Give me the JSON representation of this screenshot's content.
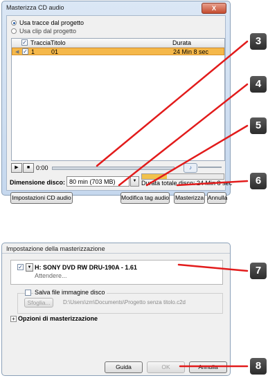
{
  "dialog1": {
    "title": "Masterizza CD audio",
    "radio_use_tracks": "Usa tracce dal progetto",
    "radio_use_clips": "Usa clip dal progetto",
    "table": {
      "col_track": "Traccia",
      "col_title": "Titolo",
      "col_duration": "Durata",
      "rows": [
        {
          "track": "1",
          "title": "01",
          "duration": "24 Min 8 sec",
          "checked": true
        }
      ]
    },
    "time_display": "0:00",
    "disc_size_label": "Dimensione disco:",
    "disc_size_value": "80 min (703 MB)",
    "total_duration": "Durata totale disco: 24 Min 8 sec",
    "btn_cd_settings": "Impostazioni CD audio",
    "btn_edit_tags": "Modifica tag audio",
    "btn_burn": "Masterizza",
    "btn_cancel": "Annulla",
    "close_glyph": "X"
  },
  "dialog2": {
    "title": "Impostazione della masterizzazione",
    "drive_name": "H: SONY DVD RW DRU-190A - 1.61",
    "drive_status": "Attendere...",
    "save_image_label": "Salva file immagine disco",
    "browse_label": "Sfoglia...",
    "image_path": "D:\\Users\\zm\\Documents\\Progetto senza titolo.c2d",
    "burn_options_label": "Opzioni di masterizzazione",
    "btn_help": "Guida",
    "btn_ok": "OK",
    "btn_cancel": "Annulla"
  },
  "callouts": [
    "3",
    "4",
    "5",
    "6",
    "7",
    "8"
  ],
  "colors": {
    "accent_blue": "#2a5fa8",
    "selection_orange": "#f5b84a",
    "callout_line": "#e21b1b",
    "callout_badge": "#3a3a3a"
  }
}
